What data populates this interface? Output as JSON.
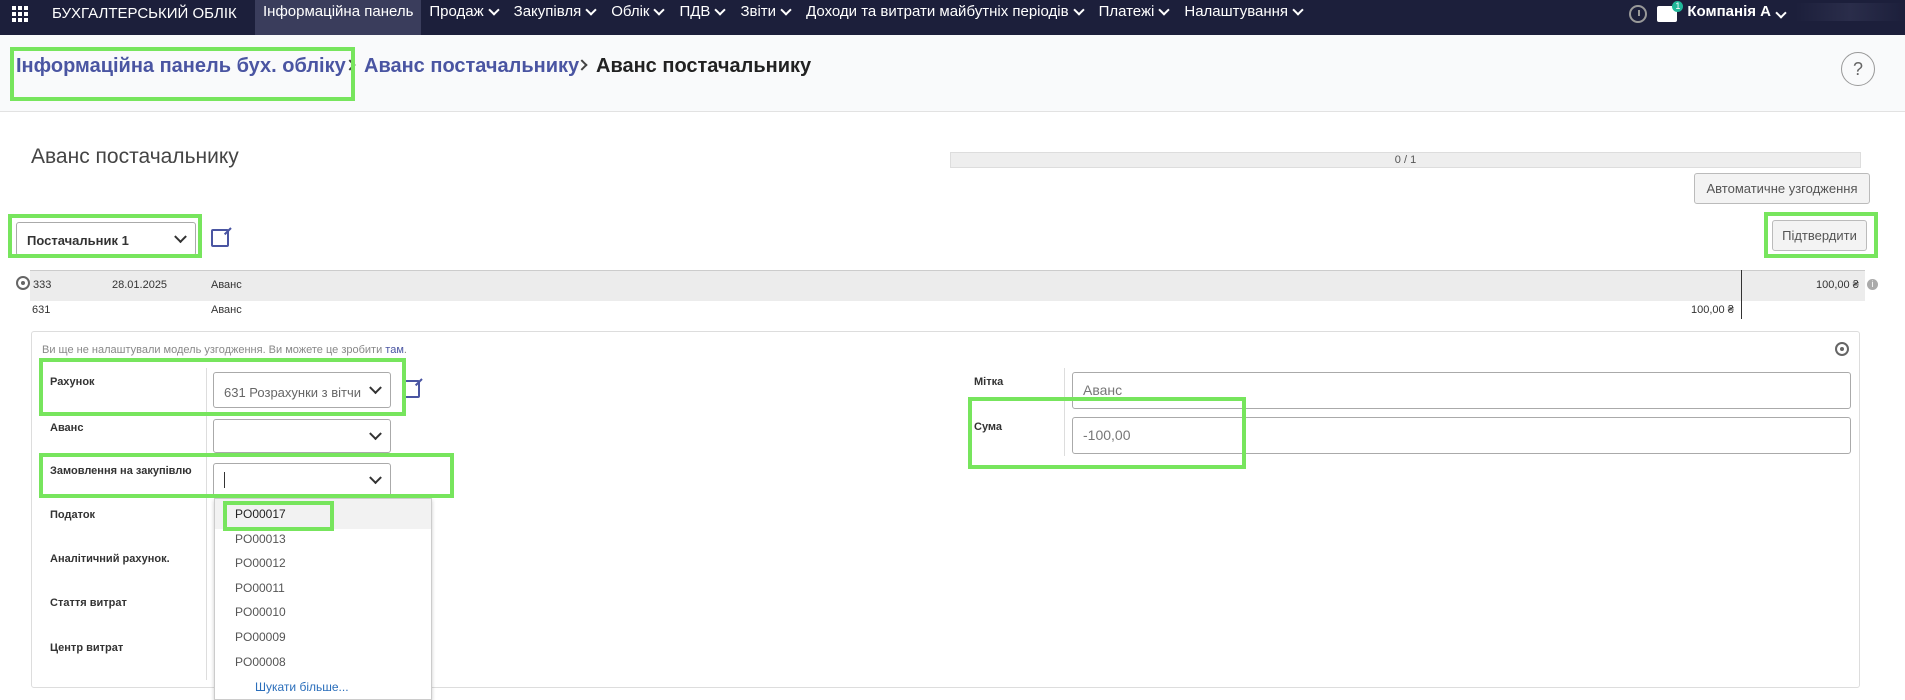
{
  "topbar": {
    "brand": "БУХГАЛТЕРСЬКИЙ ОБЛІК",
    "menu": [
      {
        "label": "Інформаційна панель"
      },
      {
        "label": "Продаж"
      },
      {
        "label": "Закупівля"
      },
      {
        "label": "Облік"
      },
      {
        "label": "ПДВ"
      },
      {
        "label": "Звіти"
      },
      {
        "label": "Доходи та витрати майбутніх періодів"
      },
      {
        "label": "Платежі"
      },
      {
        "label": "Налаштування"
      }
    ],
    "notifications": "1",
    "company": "Компанія А"
  },
  "breadcrumb": {
    "items": [
      "Інформаційна панель бух. обліку",
      "Аванс постачальнику",
      "Аванс постачальнику"
    ]
  },
  "help": "?",
  "page": {
    "title": "Аванс постачальнику",
    "progress": "0 / 1",
    "auto_btn": "Автоматичне узгодження",
    "confirm_btn": "Підтвердити",
    "partner": "Постачальник 1"
  },
  "lines": [
    {
      "account": "333",
      "date": "28.01.2025",
      "label": "Аванс",
      "amount": "100,00 ₴"
    },
    {
      "account": "631",
      "label": "Аванс",
      "amount": "100,00 ₴"
    }
  ],
  "form": {
    "hint": "Ви ще не налаштували модель узгодження. Ви можете це зробити",
    "hint_link": "там",
    "hint_end": ".",
    "account_label": "Рахунок",
    "account_value": "631 Розрахунки з вітчи",
    "advance_label": "Аванс",
    "order_label": "Замовлення на закупівлю",
    "tax_label": "Податок",
    "analytic_label": "Аналітичний рахунок.",
    "expense_label": "Стаття витрат",
    "cost_center_label": "Центр витрат",
    "tag_label": "Мітка",
    "tag_placeholder": "Аванс",
    "amount_label": "Сума",
    "amount_value": "-100,00"
  },
  "dropdown": {
    "items": [
      "PO00017",
      "PO00013",
      "PO00012",
      "PO00011",
      "PO00010",
      "PO00009",
      "PO00008"
    ],
    "more": "Шукати більше..."
  }
}
